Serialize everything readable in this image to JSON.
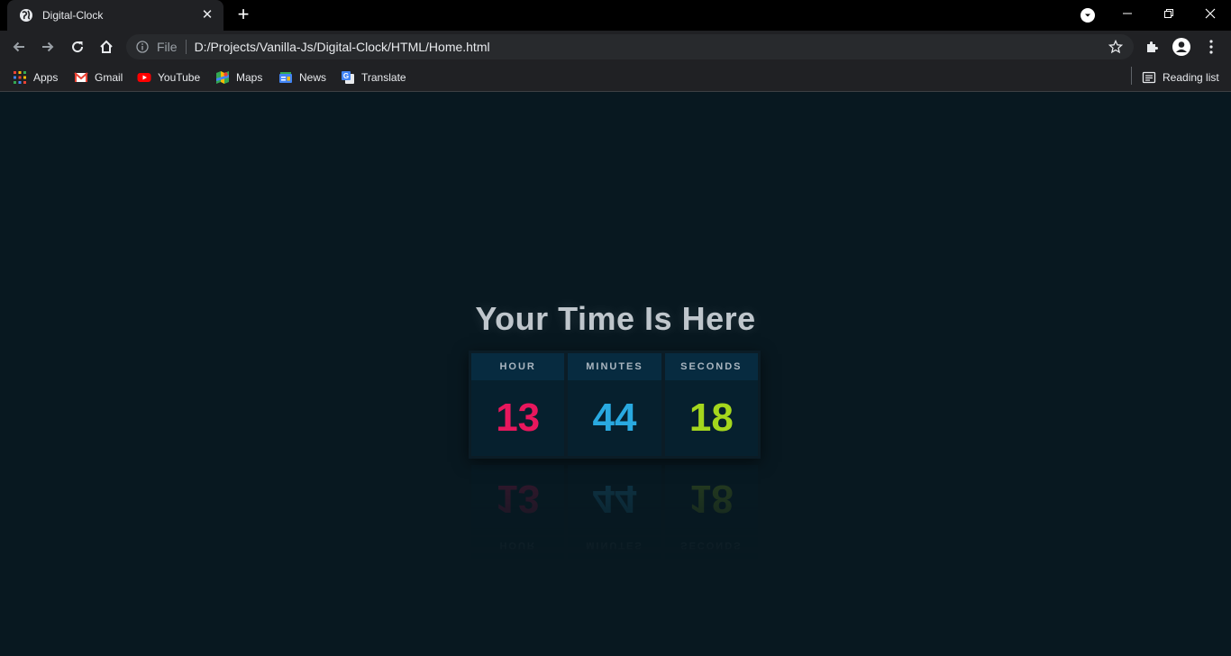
{
  "browser": {
    "tab": {
      "title": "Digital-Clock",
      "favicon": "globe-icon",
      "close": "✕"
    },
    "new_tab": "+",
    "window_controls": {
      "minimize": "—",
      "restore": "❐",
      "close": "✕"
    },
    "address_bar": {
      "scheme": "File",
      "url": "D:/Projects/Vanilla-Js/Digital-Clock/HTML/Home.html"
    },
    "bookmarks": [
      {
        "label": "Apps",
        "icon": "apps-grid-icon"
      },
      {
        "label": "Gmail",
        "icon": "gmail-icon"
      },
      {
        "label": "YouTube",
        "icon": "youtube-icon"
      },
      {
        "label": "Maps",
        "icon": "maps-icon"
      },
      {
        "label": "News",
        "icon": "news-icon"
      },
      {
        "label": "Translate",
        "icon": "translate-icon"
      }
    ],
    "reading_list": "Reading list"
  },
  "page": {
    "heading": "Your Time Is Here",
    "clock": {
      "hour": {
        "label": "HOUR",
        "value": "13",
        "color": "#e8175d"
      },
      "minutes": {
        "label": "MINUTES",
        "value": "44",
        "color": "#29a9e0"
      },
      "seconds": {
        "label": "SECONDS",
        "value": "18",
        "color": "#a4d61d"
      }
    }
  },
  "colors": {
    "page_bg": "#081820",
    "heading": "#bfc6cc",
    "label_bg": "#072b40"
  }
}
